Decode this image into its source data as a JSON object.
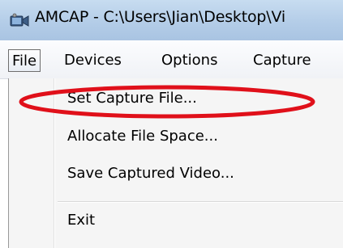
{
  "window": {
    "title": "AMCAP - C:\\Users\\Jian\\Desktop\\Vi",
    "icon": "video-camera-icon"
  },
  "menubar": {
    "items": [
      {
        "label": "File",
        "active": true
      },
      {
        "label": "Devices"
      },
      {
        "label": "Options"
      },
      {
        "label": "Capture"
      }
    ]
  },
  "file_menu": {
    "items": [
      {
        "label": "Set Capture File...",
        "highlighted": true
      },
      {
        "label": "Allocate File Space..."
      },
      {
        "label": "Save Captured Video..."
      },
      {
        "label": "Exit"
      }
    ]
  },
  "colors": {
    "annotation": "#e0101a"
  }
}
